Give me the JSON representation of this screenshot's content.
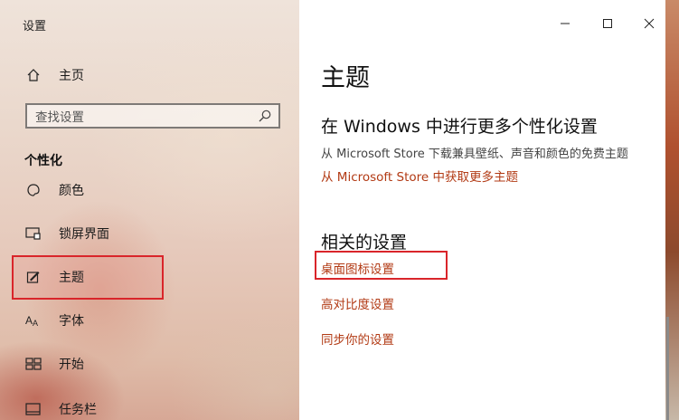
{
  "window": {
    "title": "设置"
  },
  "sidebar": {
    "home_label": "主页",
    "search_placeholder": "查找设置",
    "section_title": "个性化",
    "items": [
      {
        "label": "颜色",
        "icon": "palette-icon"
      },
      {
        "label": "锁屏界面",
        "icon": "lock-screen-icon"
      },
      {
        "label": "主题",
        "icon": "theme-brush-icon",
        "selected": true
      },
      {
        "label": "字体",
        "icon": "font-icon"
      },
      {
        "label": "开始",
        "icon": "start-menu-icon"
      },
      {
        "label": "任务栏",
        "icon": "taskbar-icon"
      }
    ]
  },
  "main": {
    "page_title": "主题",
    "windows_section": {
      "title": "在 Windows 中进行更多个性化设置",
      "description": "从 Microsoft Store 下载兼具壁纸、声音和颜色的免费主题",
      "link": "从 Microsoft Store 中获取更多主题"
    },
    "related_section": {
      "title": "相关的设置",
      "links": [
        "桌面图标设置",
        "高对比度设置",
        "同步你的设置"
      ]
    }
  },
  "colors": {
    "accent_link": "#b23a14",
    "highlight_border": "#d9252a"
  }
}
